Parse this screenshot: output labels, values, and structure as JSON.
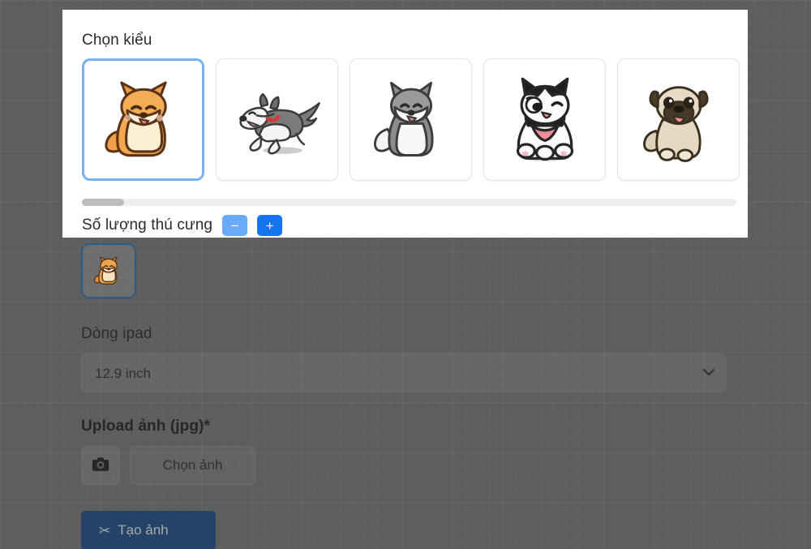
{
  "panel": {
    "title": "Chọn kiểu",
    "styles": [
      {
        "name": "shiba-sitting",
        "label": "Shiba Inu ngồi",
        "selected": true
      },
      {
        "name": "husky-running",
        "label": "Husky chạy",
        "selected": false
      },
      {
        "name": "husky-sitting-gray",
        "label": "Husky xám ngồi",
        "selected": false
      },
      {
        "name": "husky-black-white",
        "label": "Husky đen trắng",
        "selected": false
      },
      {
        "name": "pug-sitting",
        "label": "Pug ngồi",
        "selected": false
      }
    ],
    "count_label": "Số lượng thú cưng",
    "decrement_label": "−",
    "increment_label": "+",
    "scrollbar": {
      "name": "style-strip-scrollbar"
    }
  },
  "form": {
    "selected_thumbnail_label": "Shiba Inu ngồi",
    "ipad_label": "Dòng ipad",
    "ipad_selected": "12.9 inch",
    "ipad_options": [
      "12.9 inch"
    ],
    "upload_label": "Upload ảnh (jpg)*",
    "camera_icon": "camera-icon",
    "choose_image_label": "Chọn ảnh",
    "create_icon": "✂",
    "create_label": "Tạo ảnh",
    "chevron_icon": "chevron-down-icon"
  },
  "colors": {
    "page_background": "#5e5e5e",
    "panel_background": "#ffffff",
    "selected_card_border": "#76b3f5",
    "decrement_button": "#69aafa",
    "increment_button": "#1575ef",
    "create_button": "#244368",
    "thumbnail_border": "#2b5b8c"
  }
}
